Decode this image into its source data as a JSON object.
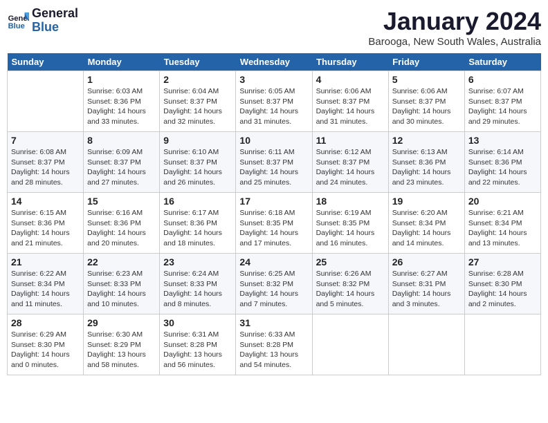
{
  "header": {
    "logo_line1": "General",
    "logo_line2": "Blue",
    "month": "January 2024",
    "location": "Barooga, New South Wales, Australia"
  },
  "weekdays": [
    "Sunday",
    "Monday",
    "Tuesday",
    "Wednesday",
    "Thursday",
    "Friday",
    "Saturday"
  ],
  "weeks": [
    [
      {
        "day": "",
        "info": ""
      },
      {
        "day": "1",
        "info": "Sunrise: 6:03 AM\nSunset: 8:36 PM\nDaylight: 14 hours\nand 33 minutes."
      },
      {
        "day": "2",
        "info": "Sunrise: 6:04 AM\nSunset: 8:37 PM\nDaylight: 14 hours\nand 32 minutes."
      },
      {
        "day": "3",
        "info": "Sunrise: 6:05 AM\nSunset: 8:37 PM\nDaylight: 14 hours\nand 31 minutes."
      },
      {
        "day": "4",
        "info": "Sunrise: 6:06 AM\nSunset: 8:37 PM\nDaylight: 14 hours\nand 31 minutes."
      },
      {
        "day": "5",
        "info": "Sunrise: 6:06 AM\nSunset: 8:37 PM\nDaylight: 14 hours\nand 30 minutes."
      },
      {
        "day": "6",
        "info": "Sunrise: 6:07 AM\nSunset: 8:37 PM\nDaylight: 14 hours\nand 29 minutes."
      }
    ],
    [
      {
        "day": "7",
        "info": "Sunrise: 6:08 AM\nSunset: 8:37 PM\nDaylight: 14 hours\nand 28 minutes."
      },
      {
        "day": "8",
        "info": "Sunrise: 6:09 AM\nSunset: 8:37 PM\nDaylight: 14 hours\nand 27 minutes."
      },
      {
        "day": "9",
        "info": "Sunrise: 6:10 AM\nSunset: 8:37 PM\nDaylight: 14 hours\nand 26 minutes."
      },
      {
        "day": "10",
        "info": "Sunrise: 6:11 AM\nSunset: 8:37 PM\nDaylight: 14 hours\nand 25 minutes."
      },
      {
        "day": "11",
        "info": "Sunrise: 6:12 AM\nSunset: 8:37 PM\nDaylight: 14 hours\nand 24 minutes."
      },
      {
        "day": "12",
        "info": "Sunrise: 6:13 AM\nSunset: 8:36 PM\nDaylight: 14 hours\nand 23 minutes."
      },
      {
        "day": "13",
        "info": "Sunrise: 6:14 AM\nSunset: 8:36 PM\nDaylight: 14 hours\nand 22 minutes."
      }
    ],
    [
      {
        "day": "14",
        "info": "Sunrise: 6:15 AM\nSunset: 8:36 PM\nDaylight: 14 hours\nand 21 minutes."
      },
      {
        "day": "15",
        "info": "Sunrise: 6:16 AM\nSunset: 8:36 PM\nDaylight: 14 hours\nand 20 minutes."
      },
      {
        "day": "16",
        "info": "Sunrise: 6:17 AM\nSunset: 8:36 PM\nDaylight: 14 hours\nand 18 minutes."
      },
      {
        "day": "17",
        "info": "Sunrise: 6:18 AM\nSunset: 8:35 PM\nDaylight: 14 hours\nand 17 minutes."
      },
      {
        "day": "18",
        "info": "Sunrise: 6:19 AM\nSunset: 8:35 PM\nDaylight: 14 hours\nand 16 minutes."
      },
      {
        "day": "19",
        "info": "Sunrise: 6:20 AM\nSunset: 8:34 PM\nDaylight: 14 hours\nand 14 minutes."
      },
      {
        "day": "20",
        "info": "Sunrise: 6:21 AM\nSunset: 8:34 PM\nDaylight: 14 hours\nand 13 minutes."
      }
    ],
    [
      {
        "day": "21",
        "info": "Sunrise: 6:22 AM\nSunset: 8:34 PM\nDaylight: 14 hours\nand 11 minutes."
      },
      {
        "day": "22",
        "info": "Sunrise: 6:23 AM\nSunset: 8:33 PM\nDaylight: 14 hours\nand 10 minutes."
      },
      {
        "day": "23",
        "info": "Sunrise: 6:24 AM\nSunset: 8:33 PM\nDaylight: 14 hours\nand 8 minutes."
      },
      {
        "day": "24",
        "info": "Sunrise: 6:25 AM\nSunset: 8:32 PM\nDaylight: 14 hours\nand 7 minutes."
      },
      {
        "day": "25",
        "info": "Sunrise: 6:26 AM\nSunset: 8:32 PM\nDaylight: 14 hours\nand 5 minutes."
      },
      {
        "day": "26",
        "info": "Sunrise: 6:27 AM\nSunset: 8:31 PM\nDaylight: 14 hours\nand 3 minutes."
      },
      {
        "day": "27",
        "info": "Sunrise: 6:28 AM\nSunset: 8:30 PM\nDaylight: 14 hours\nand 2 minutes."
      }
    ],
    [
      {
        "day": "28",
        "info": "Sunrise: 6:29 AM\nSunset: 8:30 PM\nDaylight: 14 hours\nand 0 minutes."
      },
      {
        "day": "29",
        "info": "Sunrise: 6:30 AM\nSunset: 8:29 PM\nDaylight: 13 hours\nand 58 minutes."
      },
      {
        "day": "30",
        "info": "Sunrise: 6:31 AM\nSunset: 8:28 PM\nDaylight: 13 hours\nand 56 minutes."
      },
      {
        "day": "31",
        "info": "Sunrise: 6:33 AM\nSunset: 8:28 PM\nDaylight: 13 hours\nand 54 minutes."
      },
      {
        "day": "",
        "info": ""
      },
      {
        "day": "",
        "info": ""
      },
      {
        "day": "",
        "info": ""
      }
    ]
  ]
}
